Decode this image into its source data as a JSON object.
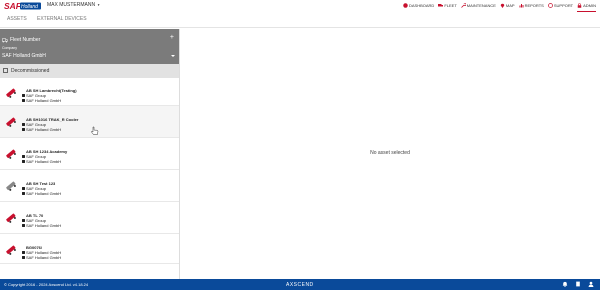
{
  "app": {
    "logo_text": "SAF Holland",
    "user_name": "MAX MUSTERMANN",
    "accent": "#c8102e",
    "footer_color": "#0a4a9a",
    "filter_color": "#7b7b7b"
  },
  "nav": [
    {
      "label": "DASHBOARD",
      "icon": "dashboard-icon"
    },
    {
      "label": "FLEET",
      "icon": "truck-icon"
    },
    {
      "label": "MAINTENANCE",
      "icon": "wrench-icon"
    },
    {
      "label": "MAP",
      "icon": "map-pin-icon"
    },
    {
      "label": "REPORTS",
      "icon": "report-icon"
    },
    {
      "label": "SUPPORT",
      "icon": "support-icon"
    },
    {
      "label": "ADMIN",
      "icon": "lock-icon"
    }
  ],
  "tabs": [
    {
      "label": "ASSETS"
    },
    {
      "label": "EXTERNAL DEVICES"
    }
  ],
  "filter": {
    "title": "Fleet Number",
    "company_label": "Company",
    "company_value": "SAF Holland GmbH",
    "decommissioned": "Decommissioned"
  },
  "assets": [
    {
      "name": "AB SH Lambrecht(Testing)",
      "group": "SAF Group",
      "company": "SAF Holland GmbH",
      "icon_color": "#c8102e"
    },
    {
      "name": "AB SH1016 TRAK_R Cooler",
      "group": "SAF Group",
      "company": "SAF Holland GmbH",
      "icon_color": "#c8102e"
    },
    {
      "name": "AB SH 1234 Academy",
      "group": "SAF Group",
      "company": "SAF Holland GmbH",
      "icon_color": "#c8102e"
    },
    {
      "name": "AB SH Test 123",
      "group": "SAF Group",
      "company": "SAF Holland GmbH",
      "icon_color": "#888888"
    },
    {
      "name": "AB TL 70",
      "group": "SAF Group",
      "company": "SAF Holland GmbH",
      "icon_color": "#c8102e"
    },
    {
      "name": "BG0076/",
      "group": "SAF Holland GmbH",
      "company": "SAF Holland GmbH",
      "icon_color": "#c8102e"
    }
  ],
  "main": {
    "empty_message": "No asset selected"
  },
  "footer": {
    "copyright": "© Copyright 2016 - 2024 Axscend Ltd. v4.18.24",
    "brand": "AXSCEND"
  }
}
